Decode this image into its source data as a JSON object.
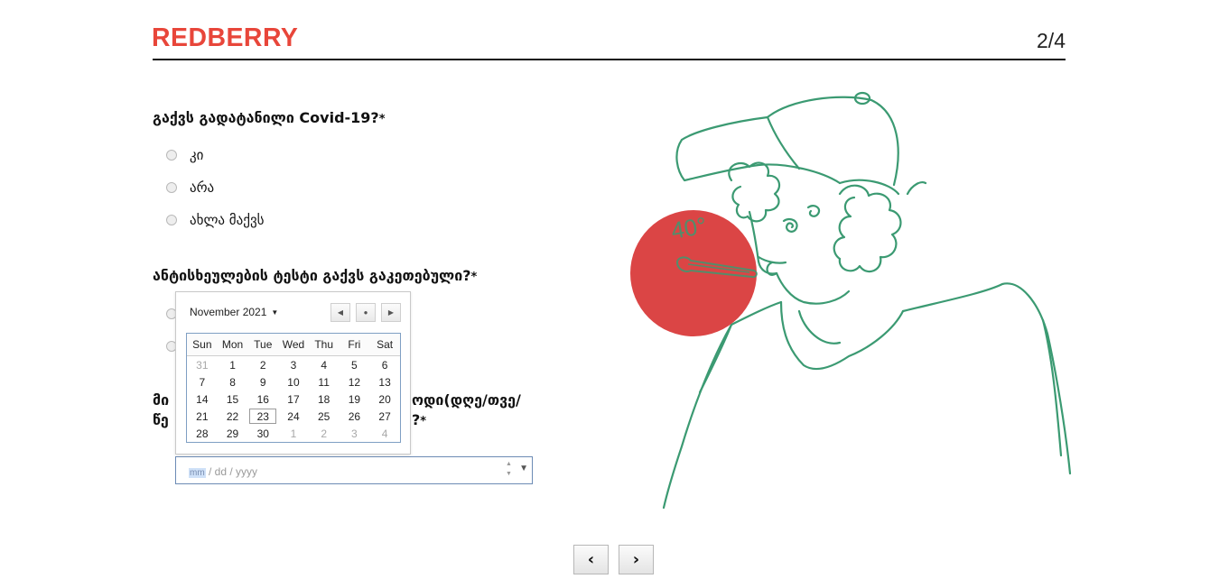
{
  "header": {
    "logo": "REDBERRY",
    "step": "2/4"
  },
  "questions": {
    "q1": {
      "text": "გაქვს გადატანილი Covid-19?",
      "required_mark": "*",
      "options": [
        "კი",
        "არა",
        "ახლა მაქვს"
      ]
    },
    "q2": {
      "text": "ანტისხეულების ტესტი გაქვს გაკეთებული?",
      "required_mark": "*"
    },
    "q3": {
      "line1_start": "მი",
      "line1_end": "ოდი(დღე/თვე/",
      "line2_start": "წე",
      "line2_end": "?",
      "required_mark": "*"
    }
  },
  "date_input": {
    "mm": "mm",
    "rest": "/ dd / yyyy",
    "spin_up": "▲",
    "spin_down": "▼",
    "dropdown": "▼"
  },
  "calendar": {
    "month_label": "November 2021",
    "caret": "▼",
    "prev": "◀",
    "today": "●",
    "next": "▶",
    "weekdays": [
      "Sun",
      "Mon",
      "Tue",
      "Wed",
      "Thu",
      "Fri",
      "Sat"
    ],
    "weeks": [
      [
        "31",
        "1",
        "2",
        "3",
        "4",
        "5",
        "6"
      ],
      [
        "7",
        "8",
        "9",
        "10",
        "11",
        "12",
        "13"
      ],
      [
        "14",
        "15",
        "16",
        "17",
        "18",
        "19",
        "20"
      ],
      [
        "21",
        "22",
        "23",
        "24",
        "25",
        "26",
        "27"
      ],
      [
        "28",
        "29",
        "30",
        "1",
        "2",
        "3",
        "4"
      ]
    ]
  },
  "illustration": {
    "thermometer_text": "40°",
    "stroke_color": "#3b9a72",
    "circle_color": "#d93b3b"
  },
  "nav": {
    "prev": "‹",
    "next": "›"
  }
}
